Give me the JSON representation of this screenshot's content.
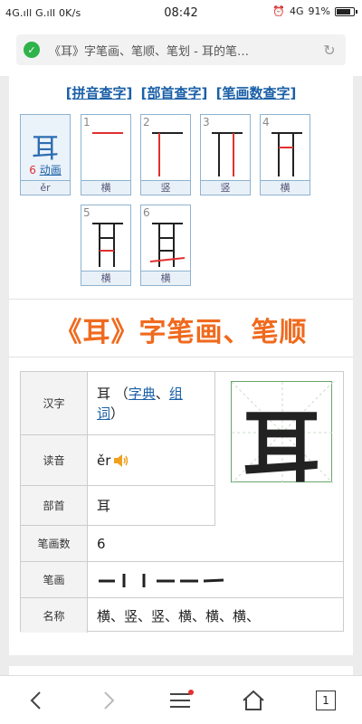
{
  "status_bar": {
    "left": "4G.ıll G.ıll 0K/s",
    "time": "08:42",
    "network": "4G",
    "battery": "91%",
    "battery_level": 0.91
  },
  "url_bar": {
    "title": "《耳》字笔画、笔顺、笔划 - 耳的笔…"
  },
  "links": {
    "pinyin": "[拼音查字]",
    "bushou": "[部首查字]",
    "bihua": "[笔画数查字]"
  },
  "character": {
    "glyph": "耳",
    "pinyin": "ěr",
    "stroke_total": "6",
    "anim_label": "动画"
  },
  "strokes": [
    {
      "n": "1",
      "name": "横"
    },
    {
      "n": "2",
      "name": "竖"
    },
    {
      "n": "3",
      "name": "竖"
    },
    {
      "n": "4",
      "name": "横"
    },
    {
      "n": "5",
      "name": "横"
    },
    {
      "n": "6",
      "name": "横"
    }
  ],
  "heading": "《耳》字笔画、笔顺",
  "info": {
    "hanzi_label": "汉字",
    "hanzi_value": "耳",
    "paren_open": "（",
    "zidian": "字典",
    "sep": "、",
    "zuci": "组词",
    "paren_close": "）",
    "duyin_label": "读音",
    "duyin_value": "ěr",
    "bushou_label": "部首",
    "bushou_value": "耳",
    "bihuashu_label": "笔画数",
    "bihuashu_value": "6",
    "bihua_label": "笔画",
    "mingcheng_label": "名称",
    "mingcheng_value": "横、竖、竖、横、横、横、"
  },
  "bottom_nav": {
    "tab_count": "1"
  },
  "colors": {
    "accent_orange": "#f06a1e",
    "link_blue": "#1a5fa6",
    "secure_green": "#2fb34a",
    "stroke_red": "#e03030"
  }
}
